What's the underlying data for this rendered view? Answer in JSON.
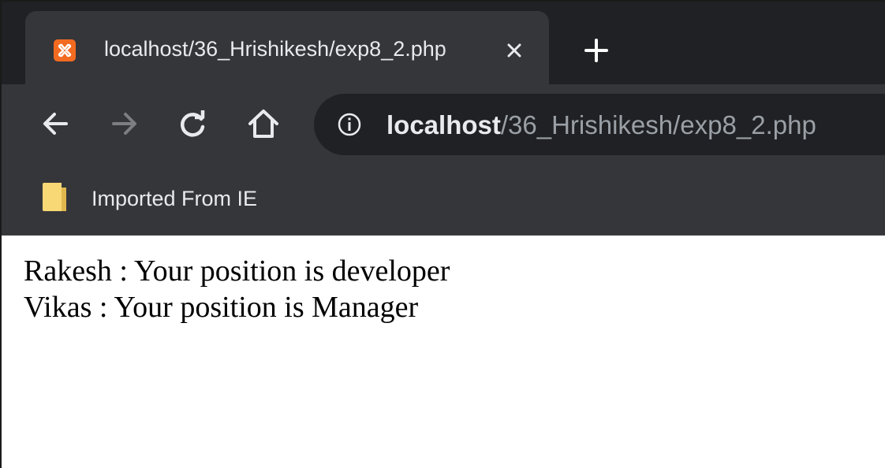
{
  "tab": {
    "title": "localhost/36_Hrishikesh/exp8_2.php",
    "favicon": "xampp-icon",
    "close_icon": "close-icon",
    "new_tab_icon": "plus-icon"
  },
  "toolbar": {
    "back_icon": "back-arrow-icon",
    "forward_icon": "forward-arrow-icon",
    "reload_icon": "reload-icon",
    "home_icon": "home-icon",
    "info_icon": "info-icon",
    "url_host": "localhost",
    "url_path": "/36_Hrishikesh/exp8_2.php"
  },
  "bookmarks": {
    "items": [
      {
        "label": "Imported From IE",
        "icon": "folder-icon"
      }
    ]
  },
  "page": {
    "lines": [
      "Rakesh : Your position is developer",
      "Vikas : Your position is Manager"
    ]
  },
  "colors": {
    "chrome_dark": "#202124",
    "chrome_toolbar": "#35363a",
    "favicon_orange": "#f26b21",
    "folder_yellow": "#f8d775"
  }
}
